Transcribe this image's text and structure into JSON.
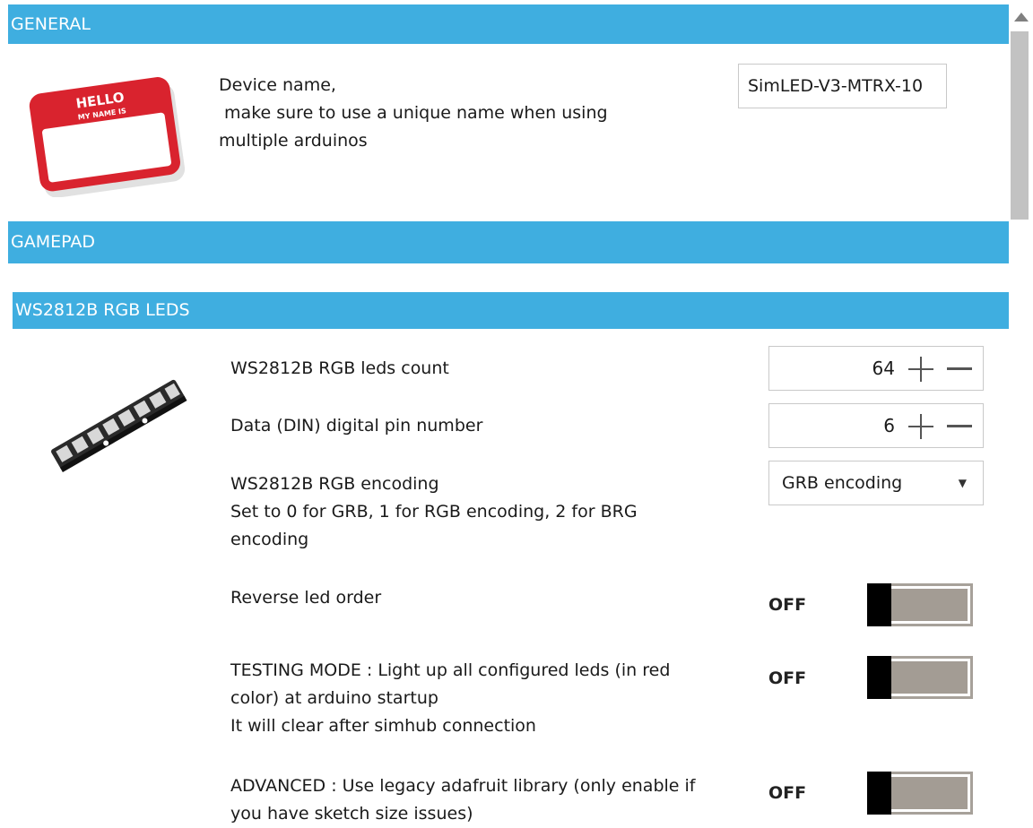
{
  "general": {
    "header": "GENERAL",
    "sticker_hello": "HELLO",
    "sticker_name": "MY NAME IS",
    "device_name_line1": "Device name,",
    "device_name_line2": " make sure to use a unique name when using",
    "device_name_line3": "multiple arduinos",
    "device_name_value": "SimLED-V3-MTRX-10"
  },
  "gamepad": {
    "header": "GAMEPAD"
  },
  "ws2812b": {
    "header": "WS2812B RGB LEDS",
    "leds_count_label": "WS2812B RGB leds count",
    "leds_count_value": "64",
    "din_pin_label": "Data (DIN) digital pin number",
    "din_pin_value": "6",
    "encoding_label_line1": "WS2812B RGB encoding",
    "encoding_label_line2": "Set to 0 for GRB, 1 for RGB encoding, 2 for BRG",
    "encoding_label_line3": "encoding",
    "encoding_value": "GRB encoding",
    "reverse_label": "Reverse led order",
    "reverse_state": "OFF",
    "testing_line1": "TESTING MODE : Light up all configured leds (in red",
    "testing_line2": "color) at arduino startup",
    "testing_line3": "It will clear after simhub connection",
    "testing_state": "OFF",
    "advanced_line1": "ADVANCED : Use legacy adafruit library (only enable if",
    "advanced_line2": "you have sketch size issues)",
    "advanced_state": "OFF"
  },
  "icons": {
    "sticker": "name-tag-sticker-icon",
    "led_strip": "led-strip-icon",
    "plus": "plus-icon",
    "minus": "minus-icon",
    "dropdown": "chevron-down-icon"
  },
  "colors": {
    "header_bg": "#3faee0",
    "sticker_red": "#d9232e",
    "toggle_track": "#a39c94"
  }
}
